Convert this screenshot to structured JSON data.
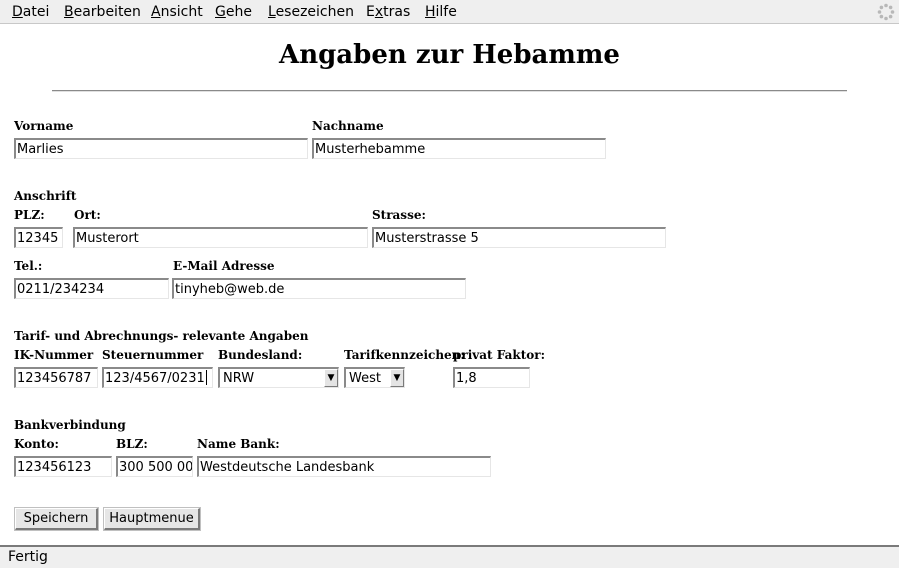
{
  "menubar": {
    "items": [
      {
        "underline": "D",
        "rest": "atei"
      },
      {
        "underline": "B",
        "rest": "earbeiten"
      },
      {
        "underline": "A",
        "rest": "nsicht"
      },
      {
        "underline": "G",
        "rest": "ehe"
      },
      {
        "underline": "L",
        "rest": "esezeichen"
      },
      {
        "pre": "E",
        "underline": "x",
        "rest": "tras"
      },
      {
        "underline": "H",
        "rest": "ilfe"
      }
    ],
    "throbber_icon": "throbber-icon"
  },
  "page": {
    "title": "Angaben zur Hebamme"
  },
  "name_section": {
    "vorname_label": "Vorname",
    "vorname_value": "Marlies",
    "nachname_label": "Nachname",
    "nachname_value": "Musterhebamme"
  },
  "address_section": {
    "heading": "Anschrift",
    "plz_label": "PLZ:",
    "plz_value": "12345",
    "ort_label": "Ort:",
    "ort_value": "Musterort",
    "strasse_label": "Strasse:",
    "strasse_value": "Musterstrasse 5",
    "tel_label": "Tel.:",
    "tel_value": "0211/234234",
    "email_label": "E-Mail Adresse",
    "email_value": "tinyheb@web.de"
  },
  "tariff_section": {
    "heading": "Tarif- und Abrechnungs- relevante Angaben",
    "ik_label": "IK-Nummer",
    "ik_value": "123456787",
    "steuer_label": "Steuernummer",
    "steuer_value": "123/4567/0231",
    "bundesland_label": "Bundesland:",
    "bundesland_value": "NRW",
    "tarif_label": "Tarifkennzeichen:",
    "tarif_value": "West",
    "faktor_label": "privat Faktor:",
    "faktor_value": "1,8"
  },
  "bank_section": {
    "heading": "Bankverbindung",
    "konto_label": "Konto:",
    "konto_value": "123456123",
    "blz_label": "BLZ:",
    "blz_value": "300 500 00",
    "bank_label": "Name Bank:",
    "bank_value": "Westdeutsche Landesbank"
  },
  "buttons": {
    "save_label": "Speichern",
    "menu_label": "Hauptmenue"
  },
  "statusbar": {
    "text": "Fertig"
  }
}
